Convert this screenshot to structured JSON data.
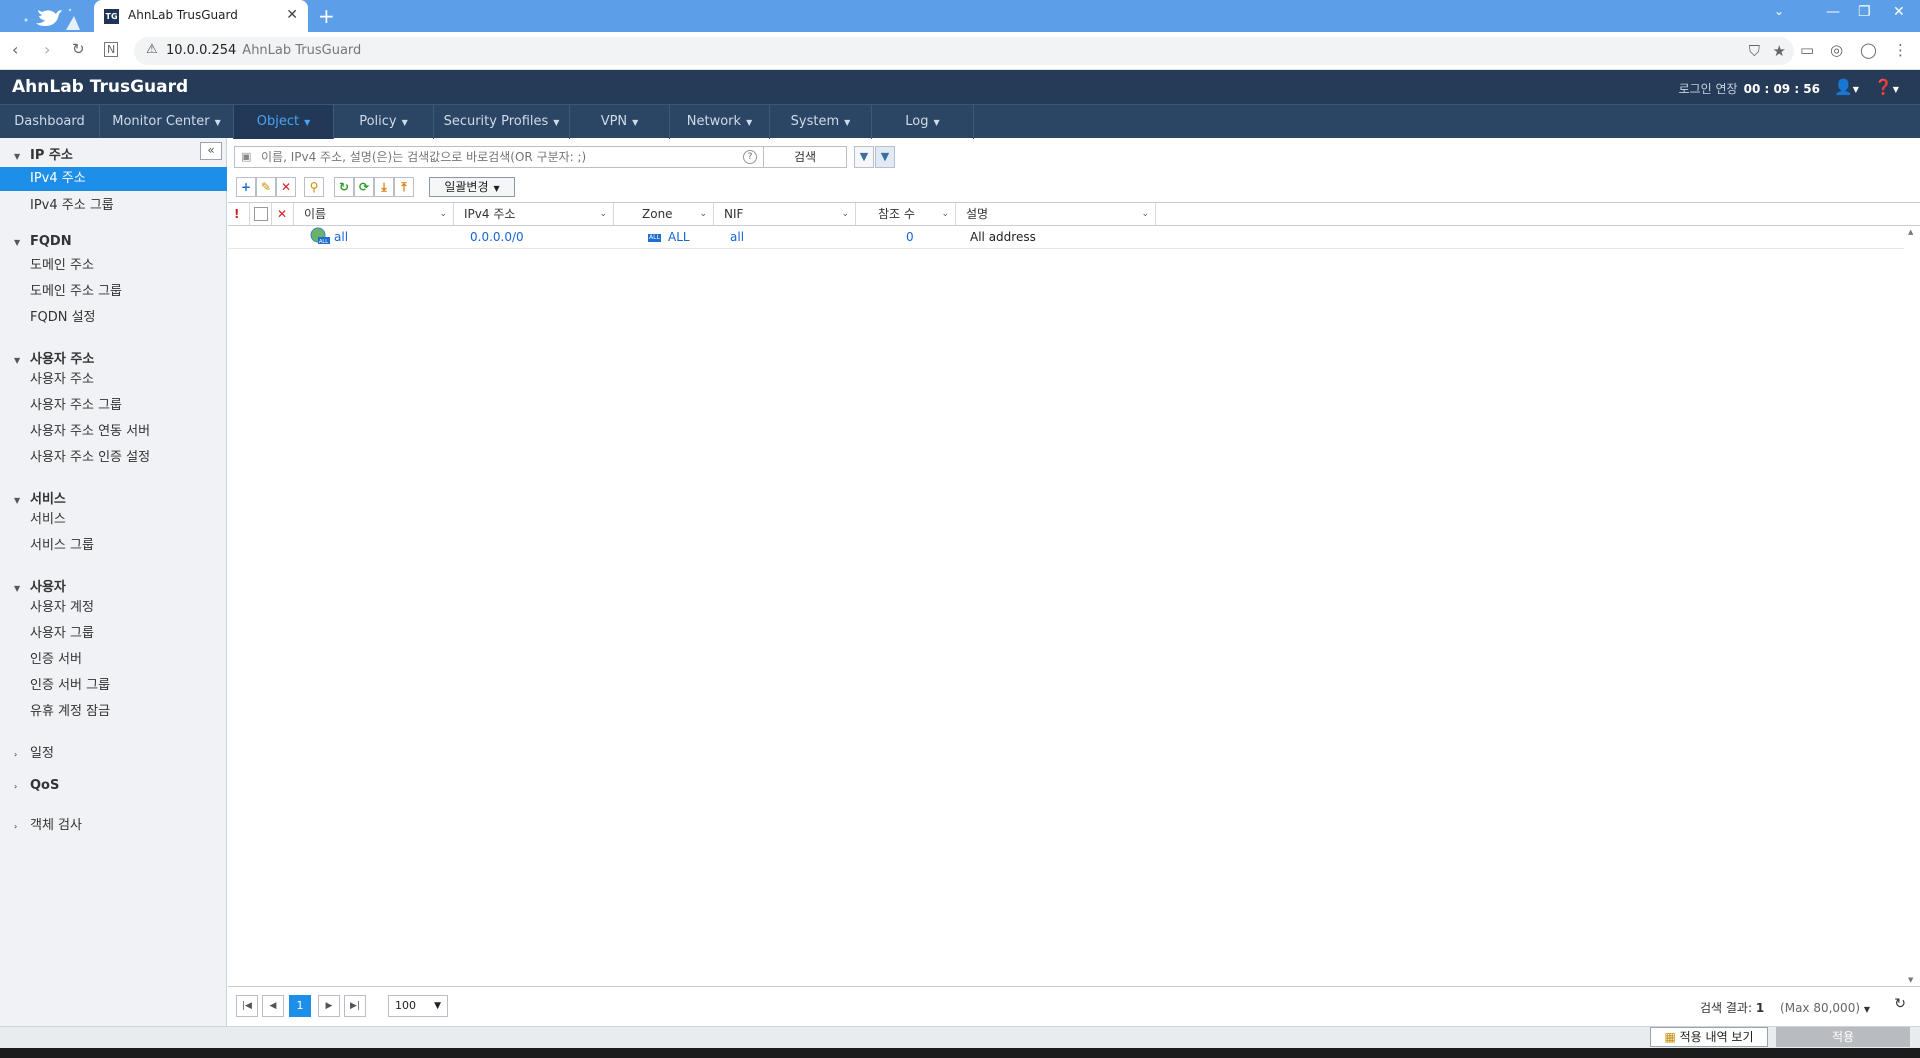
{
  "browser": {
    "tab_title": "AhnLab TrusGuard",
    "tab_favicon": "TG",
    "url": "10.0.0.254",
    "site_name": "AhnLab TrusGuard"
  },
  "app": {
    "logo": "AhnLab TrusGuard",
    "session_label": "로그인 연장",
    "session_time": "00 : 09 : 56"
  },
  "menu": [
    "Dashboard",
    "Monitor Center",
    "Object",
    "Policy",
    "Security Profiles",
    "VPN",
    "Network",
    "System",
    "Log"
  ],
  "sidebar": {
    "groups": [
      {
        "label": "IP 주소",
        "items": [
          "IPv4 주소",
          "IPv4 주소 그룹"
        ]
      },
      {
        "label": "FQDN",
        "items": [
          "도메인 주소",
          "도메인 주소 그룹",
          "FQDN 설정"
        ]
      },
      {
        "label": "사용자 주소",
        "items": [
          "사용자 주소",
          "사용자 주소 그룹",
          "사용자 주소 연동 서버",
          "사용자 주소 인증 설정"
        ]
      },
      {
        "label": "서비스",
        "items": [
          "서비스",
          "서비스 그룹"
        ]
      },
      {
        "label": "사용자",
        "items": [
          "사용자 계정",
          "사용자 그룹",
          "인증 서버",
          "인증 서버 그룹",
          "유휴 계정 잠금"
        ]
      },
      {
        "label": "일정",
        "items": []
      },
      {
        "label": "QoS",
        "items": []
      },
      {
        "label": "객체 검사",
        "items": []
      }
    ]
  },
  "search": {
    "placeholder": "이름, IPv4 주소, 설명(은)는 검색값으로 바로검색(OR 구분자: ;)",
    "button": "검색",
    "help": "?"
  },
  "toolbar": {
    "bulk_change": "일괄변경"
  },
  "table": {
    "columns": [
      "이름",
      "IPv4 주소",
      "Zone",
      "NIF",
      "참조 수",
      "설명"
    ],
    "rows": [
      {
        "name": "all",
        "ipv4": "0.0.0.0/0",
        "zone_badge": "ALL",
        "zone": "ALL",
        "nif": "all",
        "refs": "0",
        "desc": "All address"
      }
    ]
  },
  "pagination": {
    "current_page": "1",
    "per_page": "100",
    "result_label": "검색 결과:",
    "result_count": "1",
    "max_label": "(Max 80,000)"
  },
  "bottom": {
    "history_button": "적용 내역 보기",
    "apply_button": "적용"
  },
  "colors": {
    "header": "#253b58",
    "menu": "#2b4564",
    "accent": "#1e8fe8",
    "link": "#1565d8"
  }
}
